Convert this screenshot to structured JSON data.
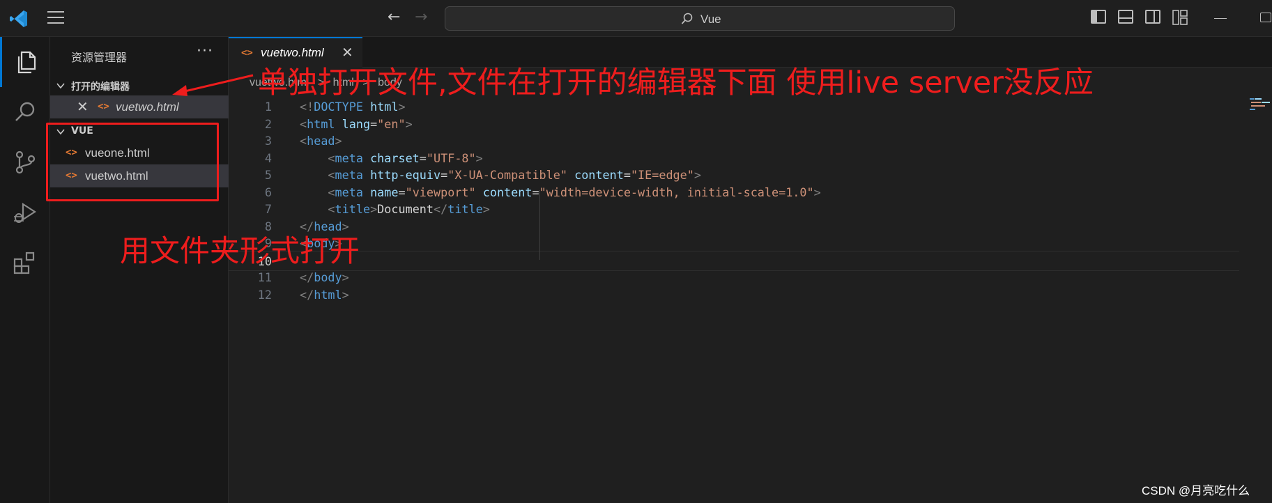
{
  "titlebar": {
    "search_text": "Vue",
    "icons": [
      "vscode-logo-icon",
      "menu-icon",
      "back-arrow-icon",
      "forward-arrow-icon",
      "search-icon",
      "toggle-sidebar-icon",
      "toggle-panel-icon",
      "toggle-secondary-sidebar-icon",
      "customize-layout-icon",
      "minimize-icon",
      "maximize-icon"
    ]
  },
  "activity_bar": {
    "items": [
      "explorer-icon",
      "search-icon",
      "source-control-icon",
      "run-debug-icon",
      "extensions-icon"
    ]
  },
  "sidebar": {
    "title": "资源管理器",
    "more_label": "···",
    "open_editors": {
      "label": "打开的编辑器",
      "files": [
        {
          "close": "✕",
          "name": "vuetwo.html"
        }
      ]
    },
    "folder": {
      "label": "VUE",
      "files": [
        {
          "name": "vueone.html"
        },
        {
          "name": "vuetwo.html"
        }
      ]
    }
  },
  "editor": {
    "tab": {
      "name": "vuetwo.html",
      "close": "✕"
    },
    "breadcrumb": [
      "vuetwo.html",
      ">",
      "html",
      ">",
      "body"
    ],
    "lines": [
      {
        "n": "1",
        "code": "<!DOCTYPE html>"
      },
      {
        "n": "2",
        "code": "<html lang=\"en\">"
      },
      {
        "n": "3",
        "code": "<head>"
      },
      {
        "n": "4",
        "code": "    <meta charset=\"UTF-8\">"
      },
      {
        "n": "5",
        "code": "    <meta http-equiv=\"X-UA-Compatible\" content=\"IE=edge\">"
      },
      {
        "n": "6",
        "code": "    <meta name=\"viewport\" content=\"width=device-width, initial-scale=1.0\">"
      },
      {
        "n": "7",
        "code": "    <title>Document</title>"
      },
      {
        "n": "8",
        "code": "</head>"
      },
      {
        "n": "9",
        "code": "<body>"
      },
      {
        "n": "10",
        "code": ""
      },
      {
        "n": "11",
        "code": "</body>"
      },
      {
        "n": "12",
        "code": "</html>"
      }
    ],
    "current_line": "10"
  },
  "annotations": {
    "text1": "单独打开文件,文件在打开的编辑器下面  使用live server没反应",
    "text2": "用文件夹形式打开",
    "color": "#ee1d1d"
  },
  "watermark": "CSDN @月亮吃什么",
  "colors": {
    "accent": "#0078d4",
    "html_file_icon": "#e37933",
    "tag": "#569cd6",
    "attribute": "#9cdcfe",
    "string": "#ce9178"
  }
}
